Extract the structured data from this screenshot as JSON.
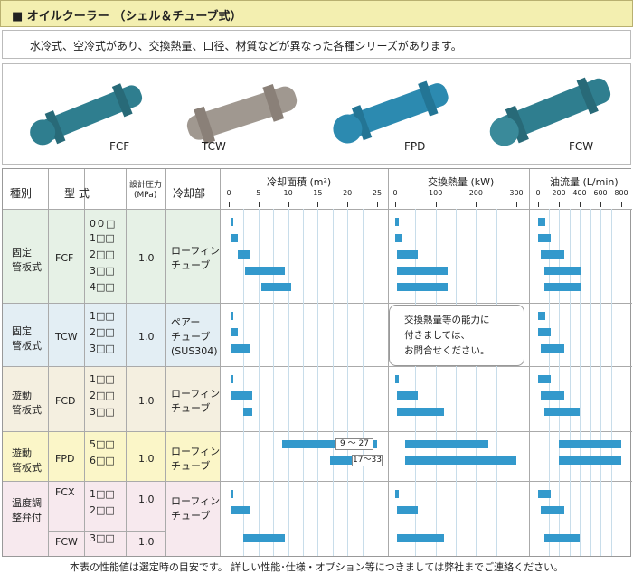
{
  "header": {
    "title": "■ オイルクーラー （シェル＆チューブ式）"
  },
  "intro": "水冷式、空冷式があり、交換熱量、口径、材質などが異なった各種シリーズがあります。",
  "photos": [
    {
      "label": "FCF"
    },
    {
      "label": "TCW"
    },
    {
      "label": "FPD"
    },
    {
      "label": "FCW"
    }
  ],
  "table": {
    "headers": {
      "kind": "種別",
      "model": "型 式",
      "pressure_line1": "設計圧力",
      "pressure_line2": "(MPa)",
      "cooling": "冷却部",
      "area": "冷却面積 (m²)",
      "heat": "交換熱量 (kW)",
      "flow": "油流量 (L/min)"
    },
    "area_ticks": [
      "0",
      "5",
      "10",
      "15",
      "20",
      "25"
    ],
    "heat_ticks": [
      "0",
      "100",
      "200",
      "300"
    ],
    "flow_ticks": [
      "0",
      "200",
      "400",
      "600",
      "800"
    ],
    "groups": [
      {
        "kind": [
          "固定",
          "管板式"
        ],
        "series": "FCF",
        "pressure": "1.0",
        "cooling": [
          "ローフィン",
          "チューブ"
        ],
        "models": [
          "0０□",
          "1□□",
          "2□□",
          "3□□",
          "4□□"
        ],
        "area": [
          [
            0.3,
            0.8
          ],
          [
            0.5,
            1.5
          ],
          [
            1.5,
            3.5
          ],
          [
            2.8,
            9.5
          ],
          [
            5.5,
            10.5
          ]
        ],
        "heat": [
          [
            0,
            8
          ],
          [
            0,
            15
          ],
          [
            5,
            55
          ],
          [
            5,
            130
          ],
          [
            5,
            130
          ]
        ],
        "flow": [
          [
            0,
            70
          ],
          [
            0,
            120
          ],
          [
            30,
            250
          ],
          [
            60,
            420
          ],
          [
            60,
            420
          ]
        ]
      },
      {
        "kind": [
          "固定",
          "管板式"
        ],
        "series": "TCW",
        "pressure": "1.0",
        "cooling": [
          "ペアー",
          "チューブ",
          "(SUS304)"
        ],
        "models": [
          "1□□",
          "2□□",
          "3□□"
        ],
        "area": [
          [
            0.3,
            0.8
          ],
          [
            0.3,
            1.5
          ],
          [
            0.5,
            3.5
          ]
        ],
        "flow": [
          [
            0,
            70
          ],
          [
            0,
            120
          ],
          [
            30,
            250
          ]
        ]
      },
      {
        "kind": [
          "遊動",
          "管板式"
        ],
        "series": "FCD",
        "pressure": "1.0",
        "cooling": [
          "ローフィン",
          "チューブ"
        ],
        "models": [
          "1□□",
          "2□□",
          "3□□"
        ],
        "area": [
          [
            0.3,
            0.8
          ],
          [
            0.5,
            4
          ],
          [
            2.5,
            4
          ]
        ],
        "heat": [
          [
            0,
            8
          ],
          [
            5,
            55
          ],
          [
            5,
            120
          ]
        ],
        "flow": [
          [
            0,
            120
          ],
          [
            30,
            250
          ],
          [
            60,
            400
          ]
        ]
      },
      {
        "kind": [
          "遊動",
          "管板式"
        ],
        "series": "FPD",
        "pressure": "1.0",
        "cooling": [
          "ローフィン",
          "チューブ"
        ],
        "models": [
          "5□□",
          "6□□"
        ],
        "area": [
          [
            9,
            27
          ],
          [
            17,
            33
          ]
        ],
        "area_labels": [
          "9 ～ 27",
          "17～33"
        ],
        "heat": [
          [
            25,
            230
          ],
          [
            25,
            325
          ]
        ],
        "flow": [
          [
            200,
            800
          ],
          [
            200,
            1000
          ]
        ]
      },
      {
        "kind": [
          "温度調",
          "整弁付"
        ],
        "series": "FCX",
        "pressure": "1.0",
        "cooling": [
          "ローフィン",
          "チューブ"
        ],
        "models": [
          "1□□",
          "2□□"
        ],
        "area": [
          [
            0.3,
            0.8
          ],
          [
            0.5,
            3.5
          ]
        ],
        "heat": [
          [
            0,
            8
          ],
          [
            5,
            55
          ]
        ],
        "flow": [
          [
            0,
            120
          ],
          [
            30,
            250
          ]
        ]
      },
      {
        "kind": [],
        "series": "FCW",
        "pressure": "1.0",
        "models": [
          "3□□"
        ],
        "area": [
          [
            2.5,
            9.5
          ]
        ],
        "heat": [
          [
            5,
            120
          ]
        ],
        "flow": [
          [
            60,
            400
          ]
        ]
      }
    ],
    "note": [
      "交換熱量等の能力に",
      "付きましては、",
      "お問合せください。"
    ]
  },
  "footer": "本表の性能値は選定時の目安です。 詳しい性能･仕様・オプション等につきましては弊社までご連絡ください。",
  "colors": {
    "bar": "#3399cc",
    "header_bg": "#f3efb0",
    "row_green": "#e6f1e6",
    "row_blue": "#e3eef4",
    "row_tan": "#f4efe0",
    "row_yellow": "#fbf6c8",
    "row_pink": "#f7e9ee"
  }
}
